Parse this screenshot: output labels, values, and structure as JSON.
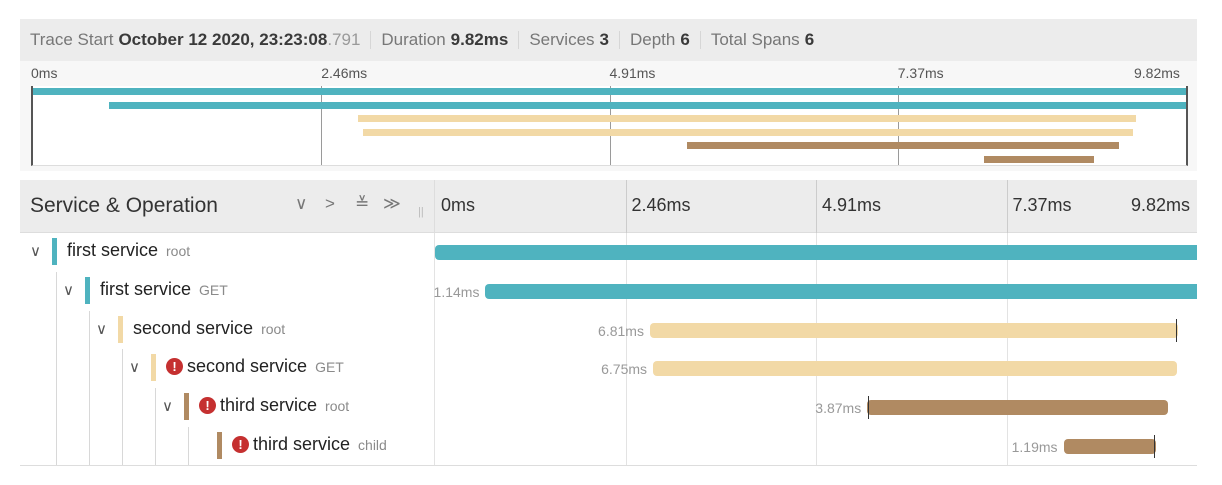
{
  "header": {
    "trace_start_label": "Trace Start",
    "trace_start_value": "October 12 2020, 23:23:08",
    "trace_start_ms": ".791",
    "duration_label": "Duration",
    "duration_value": "9.82ms",
    "services_label": "Services",
    "services_value": "3",
    "depth_label": "Depth",
    "depth_value": "6",
    "spans_label": "Total Spans",
    "spans_value": "6"
  },
  "minimap": {
    "ticks": [
      "0ms",
      "2.46ms",
      "4.91ms",
      "7.37ms",
      "9.82ms"
    ]
  },
  "columns": {
    "title": "Service & Operation",
    "controls": {
      "collapse_one": "∨",
      "expand_one": ">",
      "collapse_all": "≚",
      "expand_all": "≫"
    },
    "time_ticks": [
      "0ms",
      "2.46ms",
      "4.91ms",
      "7.37ms",
      "9.82ms"
    ]
  },
  "colors": {
    "first_service": "#4fb3bf",
    "second_service": "#f2d9a6",
    "third_service": "#b08a62",
    "error": "#c53030"
  },
  "spans": [
    {
      "service": "first service",
      "operation": "root",
      "duration": "",
      "error": false,
      "expanded": true,
      "start_ms": 0.0,
      "duration_ms": 9.82,
      "color_key": "first_service"
    },
    {
      "service": "first service",
      "operation": "GET",
      "duration": "1.14ms",
      "error": false,
      "expanded": true,
      "start_ms": 0.65,
      "duration_ms": 9.17,
      "color_key": "first_service"
    },
    {
      "service": "second service",
      "operation": "root",
      "duration": "6.81ms",
      "error": false,
      "expanded": true,
      "start_ms": 2.77,
      "duration_ms": 6.81,
      "color_key": "second_service"
    },
    {
      "service": "second service",
      "operation": "GET",
      "duration": "6.75ms",
      "error": true,
      "expanded": true,
      "start_ms": 2.81,
      "duration_ms": 6.75,
      "color_key": "second_service"
    },
    {
      "service": "third service",
      "operation": "root",
      "duration": "3.87ms",
      "error": true,
      "expanded": true,
      "start_ms": 5.57,
      "duration_ms": 3.87,
      "color_key": "third_service"
    },
    {
      "service": "third service",
      "operation": "child",
      "duration": "1.19ms",
      "error": true,
      "expanded": false,
      "start_ms": 8.1,
      "duration_ms": 1.19,
      "color_key": "third_service"
    }
  ]
}
